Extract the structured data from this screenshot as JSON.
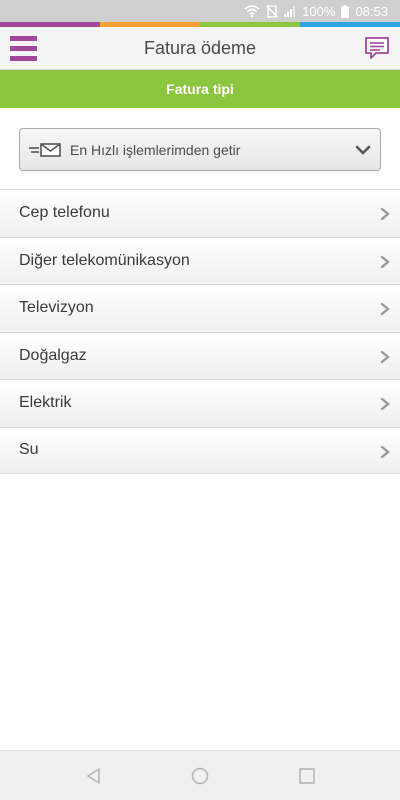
{
  "status_bar": {
    "battery": "100%",
    "time": "08:53",
    "icons": [
      "wifi-icon",
      "mute-icon",
      "signal-icon",
      "battery-icon"
    ]
  },
  "brand_colors": [
    "#a0479b",
    "#f7a234",
    "#8cc63f",
    "#2ea7e0"
  ],
  "header": {
    "title": "Fatura ödeme",
    "menu_icon": "menu-icon",
    "chat_icon": "chat-icon"
  },
  "section": {
    "title": "Fatura tipi"
  },
  "quick_select": {
    "label": "En Hızlı işlemlerimden getir",
    "icon": "quick-mail-icon"
  },
  "bill_types": [
    "Cep telefonu",
    "Diğer telekomünikasyon",
    "Televizyon",
    "Doğalgaz",
    "Elektrik",
    "Su"
  ],
  "nav": [
    "back-icon",
    "home-icon",
    "recents-icon"
  ]
}
